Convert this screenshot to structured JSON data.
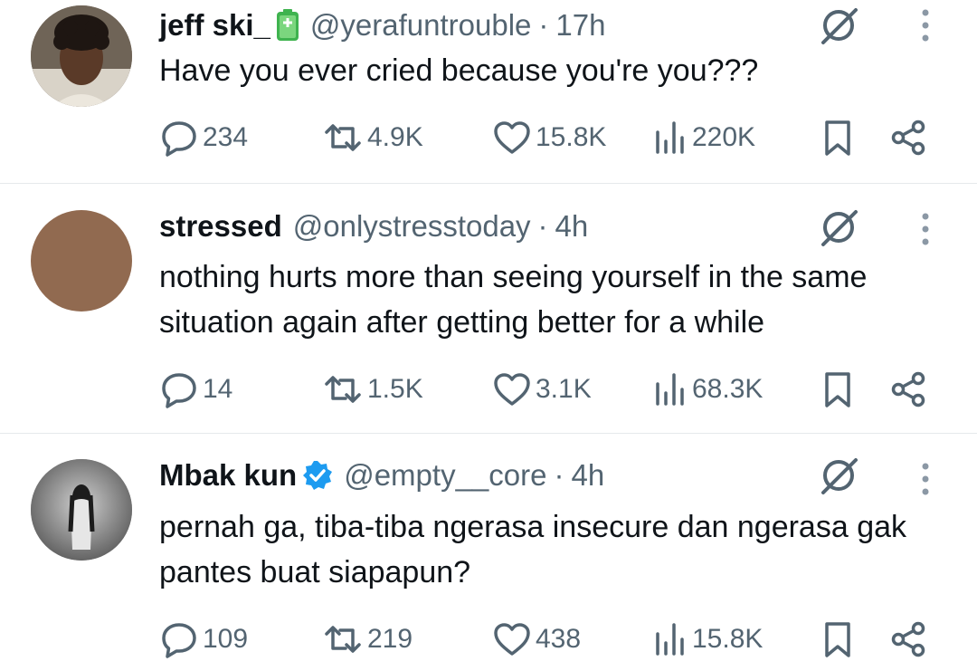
{
  "colors": {
    "text": "#0f1419",
    "secondary": "#536471",
    "divider": "#e6e9ec",
    "verified": "#1d9bf0",
    "battery": "#3fb34f"
  },
  "tweets": [
    {
      "name": "jeff ski_",
      "name_icon": "battery-icon",
      "handle": "@yerafuntrouble",
      "time": "17h",
      "text": "Have you ever cried because you're you???",
      "stats": {
        "replies": "234",
        "reposts": "4.9K",
        "likes": "15.8K",
        "views": "220K"
      }
    },
    {
      "name": "stressed",
      "handle": "@onlystresstoday",
      "time": "4h",
      "text": "nothing hurts more than seeing yourself in the same situation again after getting better for a while",
      "stats": {
        "replies": "14",
        "reposts": "1.5K",
        "likes": "3.1K",
        "views": "68.3K"
      }
    },
    {
      "name": "Mbak kun",
      "name_icon": "verified-badge-icon",
      "handle": "@empty__core",
      "time": "4h",
      "text": "pernah ga, tiba-tiba ngerasa insecure dan ngerasa gak pantes buat siapapun?",
      "stats": {
        "replies": "109",
        "reposts": "219",
        "likes": "438",
        "views": "15.8K"
      }
    }
  ],
  "separator": "·"
}
